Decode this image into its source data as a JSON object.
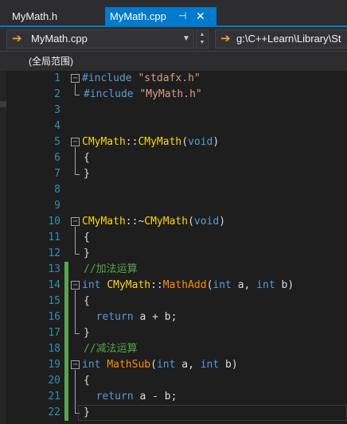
{
  "tabs": [
    {
      "label": "MyMath.h",
      "active": false
    },
    {
      "label": "MyMath.cpp",
      "active": true
    }
  ],
  "icons": {
    "pin": "⊣",
    "close": "✕",
    "nav_arrow": "➔",
    "dropdown": "▼",
    "spin_up": "▲",
    "spin_down": "▼"
  },
  "navbar": {
    "file_combo": "MyMath.cpp",
    "path_combo": "g:\\C++Learn\\Library\\St",
    "scope": "(全局范围)"
  },
  "colors": {
    "accent": "#007acc",
    "keyword": "#569cd6",
    "string": "#d69d85",
    "class": "#ffd700",
    "function": "#ff8c00",
    "comment": "#57a64a",
    "line_number": "#2b91af"
  },
  "editor": {
    "lines": [
      {
        "n": "1",
        "tokens": [
          {
            "t": "#include ",
            "c": "kw"
          },
          {
            "t": "\"stdafx.h\"",
            "c": "str"
          }
        ]
      },
      {
        "n": "2",
        "tokens": [
          {
            "t": "#include ",
            "c": "kw"
          },
          {
            "t": "\"MyMath.h\"",
            "c": "str"
          }
        ]
      },
      {
        "n": "3",
        "tokens": []
      },
      {
        "n": "4",
        "tokens": []
      },
      {
        "n": "5",
        "tokens": [
          {
            "t": "CMyMath",
            "c": "cls"
          },
          {
            "t": "::",
            "c": "pl"
          },
          {
            "t": "CMyMath",
            "c": "cls"
          },
          {
            "t": "(",
            "c": "pl"
          },
          {
            "t": "void",
            "c": "kw"
          },
          {
            "t": ")",
            "c": "pl"
          }
        ]
      },
      {
        "n": "6",
        "tokens": [
          {
            "t": "{",
            "c": "pl"
          }
        ]
      },
      {
        "n": "7",
        "tokens": [
          {
            "t": "}",
            "c": "pl"
          }
        ]
      },
      {
        "n": "8",
        "tokens": []
      },
      {
        "n": "9",
        "tokens": []
      },
      {
        "n": "10",
        "tokens": [
          {
            "t": "CMyMath",
            "c": "cls"
          },
          {
            "t": "::~",
            "c": "pl"
          },
          {
            "t": "CMyMath",
            "c": "cls"
          },
          {
            "t": "(",
            "c": "pl"
          },
          {
            "t": "void",
            "c": "kw"
          },
          {
            "t": ")",
            "c": "pl"
          }
        ]
      },
      {
        "n": "11",
        "tokens": [
          {
            "t": "{",
            "c": "pl"
          }
        ]
      },
      {
        "n": "12",
        "tokens": [
          {
            "t": "}",
            "c": "pl"
          }
        ]
      },
      {
        "n": "13",
        "tokens": [
          {
            "t": "//加法运算",
            "c": "cm"
          }
        ]
      },
      {
        "n": "14",
        "tokens": [
          {
            "t": "int ",
            "c": "kw"
          },
          {
            "t": "CMyMath",
            "c": "cls"
          },
          {
            "t": "::",
            "c": "pl"
          },
          {
            "t": "MathAdd",
            "c": "fn"
          },
          {
            "t": "(",
            "c": "pl"
          },
          {
            "t": "int",
            "c": "kw"
          },
          {
            "t": " a, ",
            "c": "pl"
          },
          {
            "t": "int",
            "c": "kw"
          },
          {
            "t": " b)",
            "c": "pl"
          }
        ]
      },
      {
        "n": "15",
        "tokens": [
          {
            "t": "{",
            "c": "pl"
          }
        ]
      },
      {
        "n": "16",
        "tokens": [
          {
            "t": "  return",
            "c": "kw"
          },
          {
            "t": " a + b;",
            "c": "pl"
          }
        ]
      },
      {
        "n": "17",
        "tokens": [
          {
            "t": "}",
            "c": "pl"
          }
        ]
      },
      {
        "n": "18",
        "tokens": [
          {
            "t": "//减法运算",
            "c": "cm"
          }
        ]
      },
      {
        "n": "19",
        "tokens": [
          {
            "t": "int ",
            "c": "kw"
          },
          {
            "t": "MathSub",
            "c": "fn"
          },
          {
            "t": "(",
            "c": "pl"
          },
          {
            "t": "int",
            "c": "kw"
          },
          {
            "t": " a, ",
            "c": "pl"
          },
          {
            "t": "int",
            "c": "kw"
          },
          {
            "t": " b)",
            "c": "pl"
          }
        ]
      },
      {
        "n": "20",
        "tokens": [
          {
            "t": "{",
            "c": "pl"
          }
        ]
      },
      {
        "n": "21",
        "tokens": [
          {
            "t": "  return",
            "c": "kw"
          },
          {
            "t": " a - b;",
            "c": "pl"
          }
        ]
      },
      {
        "n": "22",
        "tokens": [
          {
            "t": "}",
            "c": "pl"
          }
        ]
      }
    ]
  }
}
